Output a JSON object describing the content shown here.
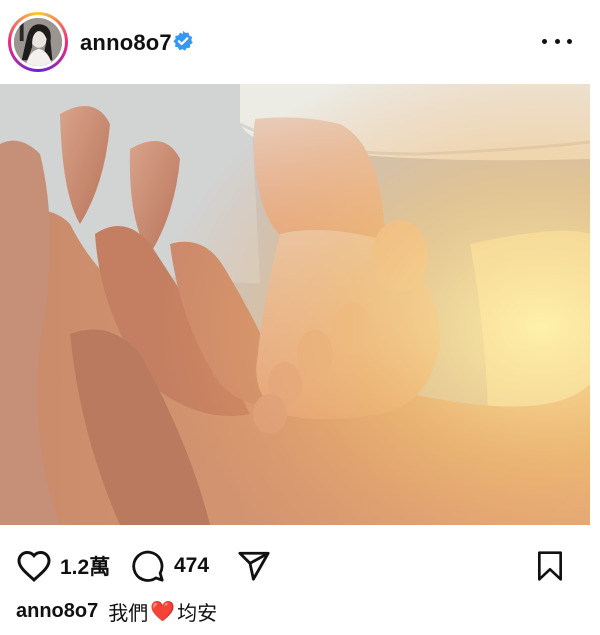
{
  "header": {
    "username": "anno8o7",
    "verified_icon": "verified-badge-icon",
    "more_icon": "more-options-icon"
  },
  "photo": {
    "subject_icon": "post-photo"
  },
  "actions": {
    "like_icon": "heart-outline-icon",
    "like_count": "1.2萬",
    "comment_icon": "comment-icon",
    "comment_count": "474",
    "share_icon": "send-icon",
    "save_icon": "bookmark-icon"
  },
  "caption": {
    "username": "anno8o7",
    "text_before": "我們",
    "emoji": "❤️",
    "text_after": "均安"
  },
  "colors": {
    "verified": "#3897f0",
    "heart_emoji": "#e3243b",
    "text": "#111111"
  }
}
